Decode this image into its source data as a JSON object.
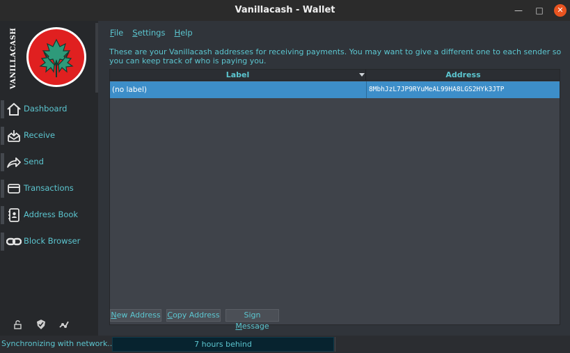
{
  "window": {
    "title": "Vanillacash - Wallet",
    "minimize_icon": "minimize-icon",
    "maximize_icon": "maximize-icon",
    "close_icon": "close-icon",
    "close_color": "#e95420"
  },
  "brand": {
    "logo_text": "VANILLACASH",
    "logo_icon": "maple-leaf-logo",
    "logo_color": "#e02020",
    "leaf_color": "#2e9a7a"
  },
  "sidebar": {
    "items": [
      {
        "label": "Dashboard",
        "icon": "home-icon"
      },
      {
        "label": "Receive",
        "icon": "inbox-icon"
      },
      {
        "label": "Send",
        "icon": "send-arrow-icon"
      },
      {
        "label": "Transactions",
        "icon": "card-icon"
      },
      {
        "label": "Address Book",
        "icon": "address-book-icon"
      },
      {
        "label": "Block Browser",
        "icon": "chain-link-icon"
      }
    ],
    "tray_icons": [
      "lock-open-icon",
      "shield-check-icon",
      "network-icon"
    ]
  },
  "menu": {
    "items": [
      {
        "label": "File",
        "mnemonic": "F",
        "rest": "ile"
      },
      {
        "label": "Settings",
        "mnemonic": "S",
        "rest": "ettings"
      },
      {
        "label": "Help",
        "mnemonic": "H",
        "rest": "elp"
      }
    ]
  },
  "main": {
    "info": "These are your Vanillacash addresses for receiving payments. You may want to give a different one to each sender so you can keep track of who is paying you.",
    "table": {
      "columns": [
        "Label",
        "Address"
      ],
      "rows": [
        {
          "label": "(no label)",
          "address": "8MbhJzL7JP9RYuMeAL99HA8LGS2HYk3JTP"
        }
      ]
    },
    "buttons": {
      "new_address": {
        "pre": "",
        "mnemonic": "N",
        "post": "ew Address"
      },
      "copy_address": {
        "pre": "",
        "mnemonic": "C",
        "post": "opy Address"
      },
      "sign_message": {
        "pre": "Sign ",
        "mnemonic": "M",
        "post": "essage"
      }
    }
  },
  "status": {
    "text": "Synchronizing with network...",
    "progress_text": "7 hours behind",
    "progress_fraction": 0.0
  },
  "colors": {
    "accent": "#5cc6d0",
    "selection": "#3d8ec9"
  }
}
